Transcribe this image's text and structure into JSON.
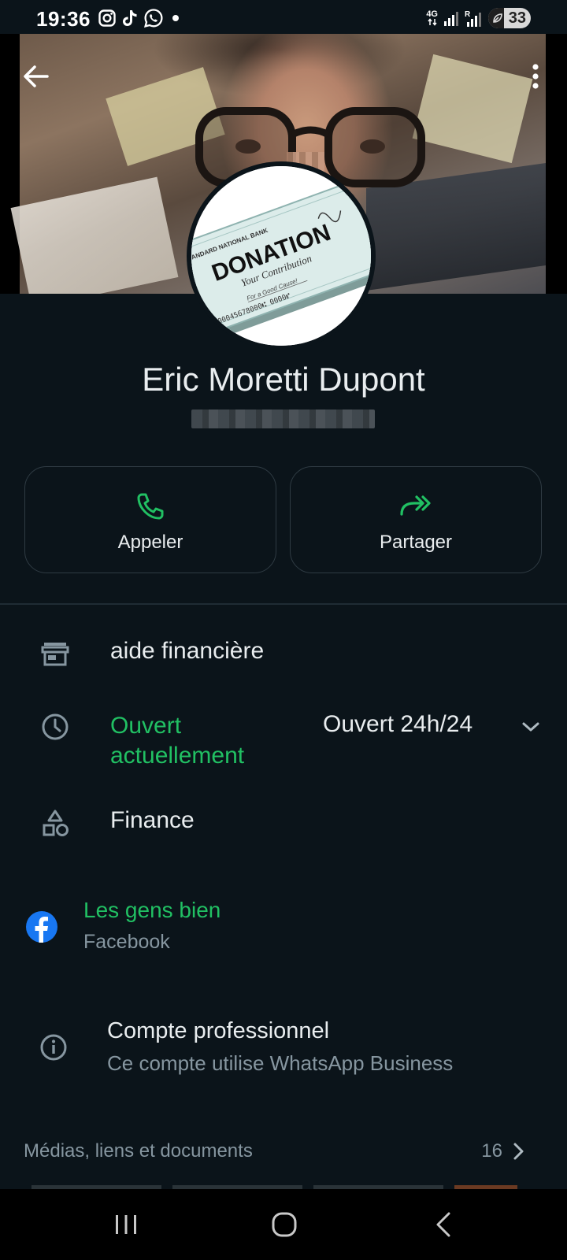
{
  "status_bar": {
    "time": "19:36",
    "network_type": "4G",
    "battery_level": "33",
    "battery_fraction": 0.33,
    "notification_icons": [
      "instagram-icon",
      "tiktok-icon",
      "whatsapp-icon",
      "dot-icon"
    ],
    "system_icons": [
      "signal-icon",
      "signal-roaming-icon",
      "battery-icon"
    ]
  },
  "header": {
    "back_icon": "arrow-left-icon",
    "menu_icon": "more-vertical-icon"
  },
  "avatar": {
    "bank": "STANDARD NATIONAL BANK",
    "title": "DONATION",
    "subtitle": "Your Contribution",
    "memo": "For a Good Cause!",
    "account": "⑆00045678000⑆ 0000⑈"
  },
  "profile": {
    "name": "Eric Moretti Dupont"
  },
  "actions": [
    {
      "label": "Appeler",
      "icon": "phone-icon"
    },
    {
      "label": "Partager",
      "icon": "share-forward-icon"
    }
  ],
  "business_info": {
    "description": "aide financière",
    "hours_status": "Ouvert actuellement",
    "hours_value": "Ouvert 24h/24",
    "category": "Finance"
  },
  "facebook": {
    "name": "Les gens bien",
    "platform": "Facebook"
  },
  "account_type": {
    "title": "Compte professionnel",
    "subtitle": "Ce compte utilise WhatsApp Business"
  },
  "media": {
    "label": "Médias, liens et documents",
    "count": "16"
  },
  "colors": {
    "background": "#0b141a",
    "accent_green": "#21c063",
    "text_primary": "#e9edef",
    "text_secondary": "#8696a0",
    "facebook_blue": "#1877f2"
  }
}
